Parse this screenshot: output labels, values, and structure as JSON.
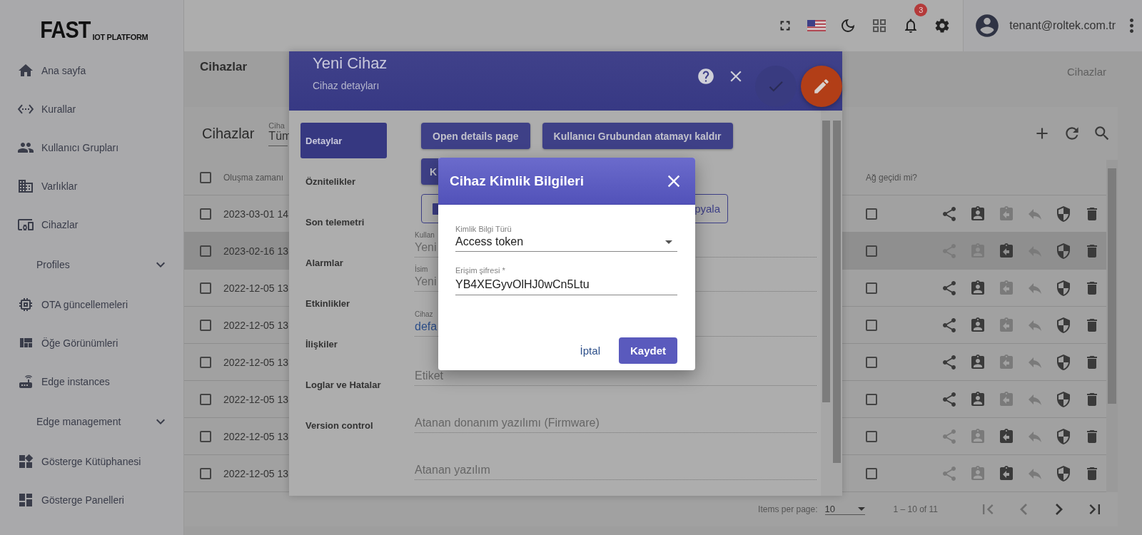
{
  "logo": {
    "title": "FAST",
    "subtitle": "IOT PLATFORM"
  },
  "sidebar": {
    "items": [
      {
        "kind": "link",
        "label": "Ana sayfa"
      },
      {
        "kind": "link",
        "label": "Kurallar"
      },
      {
        "kind": "link",
        "label": "Kullanıcı Grupları"
      },
      {
        "kind": "link",
        "label": "Varlıklar"
      },
      {
        "kind": "link",
        "label": "Cihazlar"
      },
      {
        "kind": "group",
        "label": "Profiles",
        "expanded": false
      },
      {
        "kind": "link",
        "label": "OTA güncellemeleri"
      },
      {
        "kind": "link",
        "label": "Öğe Görünümleri"
      },
      {
        "kind": "link",
        "label": "Edge instances"
      },
      {
        "kind": "group",
        "label": "Edge management",
        "expanded": false
      },
      {
        "kind": "link",
        "label": "Gösterge Kütüphanesi"
      },
      {
        "kind": "link",
        "label": "Gösterge Panelleri"
      }
    ]
  },
  "header": {
    "notifications": "3",
    "user_email": "tenant@roltek.com.tr"
  },
  "page": {
    "title": "Cihazlar",
    "breadcrumb": "Cihazlar"
  },
  "table": {
    "title": "Cihazlar",
    "all_checked": false,
    "filter": {
      "label": "Ciha",
      "value": "Tüm"
    },
    "columns": [
      "Oluşma zamanı",
      "Ağ geçidi mi?"
    ],
    "rows": [
      {
        "created": "2023-03-01 14",
        "checked": false,
        "selected": false,
        "gateway": false,
        "assigned": false
      },
      {
        "created": "2023-02-16 13",
        "checked": false,
        "selected": true,
        "gateway": false,
        "assigned": true
      },
      {
        "created": "2022-12-05 13",
        "checked": false,
        "selected": false,
        "gateway": false,
        "assigned": false
      },
      {
        "created": "2022-12-05 13",
        "checked": false,
        "selected": false,
        "gateway": false,
        "assigned": false
      },
      {
        "created": "2022-12-05 13",
        "checked": false,
        "selected": false,
        "gateway": false,
        "assigned": false
      },
      {
        "created": "2022-12-05 13",
        "checked": false,
        "selected": false,
        "gateway": false,
        "assigned": false
      },
      {
        "created": "2022-12-05 13",
        "checked": false,
        "selected": false,
        "gateway": false,
        "assigned": true
      },
      {
        "created": "2022-12-05 13",
        "checked": false,
        "selected": false,
        "gateway": false,
        "assigned": true
      }
    ]
  },
  "paginator": {
    "label": "Items per page:",
    "page_size": "10",
    "range": "1 – 10 of 11"
  },
  "device_panel": {
    "title": "Yeni Cihaz",
    "subtitle": "Cihaz detayları",
    "tabs": [
      {
        "label": "Detaylar",
        "selected": true
      },
      {
        "label": "Öznitelikler",
        "selected": false
      },
      {
        "label": "Son telemetri",
        "selected": false
      },
      {
        "label": "Alarmlar",
        "selected": false
      },
      {
        "label": "Etkinlikler",
        "selected": false
      },
      {
        "label": "İlişkiler",
        "selected": false
      },
      {
        "label": "Loglar ve Hatalar",
        "selected": false
      },
      {
        "label": "Version control",
        "selected": false
      }
    ],
    "buttons": [
      "Open details page",
      "Kullanıcı Grubundan atamayı kaldır",
      "K"
    ],
    "copy_button": "pyala",
    "fields": [
      {
        "kind": "text",
        "label": "Kullan",
        "value": "Yeni"
      },
      {
        "kind": "text",
        "label": "İsim",
        "value": "Yeni"
      },
      {
        "kind": "link",
        "label": "Cihaz",
        "value": "defa"
      },
      {
        "kind": "empty",
        "placeholder": "Etiket"
      },
      {
        "kind": "empty",
        "placeholder": "Atanan donanım yazılımı (Firmware)"
      },
      {
        "kind": "empty",
        "placeholder": "Atanan yazılım"
      }
    ]
  },
  "dialog": {
    "title": "Cihaz Kimlik Bilgileri",
    "credential_type": {
      "label": "Kimlik Bilgi Türü",
      "value": "Access token"
    },
    "access_token": {
      "label": "Erişim şifresi *",
      "value": "YB4XEGyvOlHJ0wCn5Ltu"
    },
    "cancel": "İptal",
    "save": "Kaydet"
  }
}
